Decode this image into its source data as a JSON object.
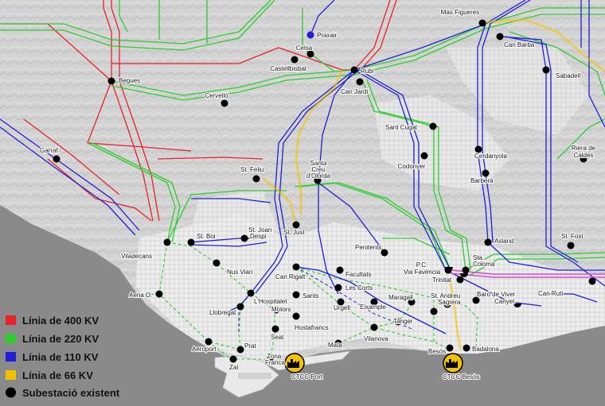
{
  "legend": {
    "line_400": {
      "label": "Línia de 400 KV",
      "color": "#e8202a"
    },
    "line_220": {
      "label": "Línia de 220 KV",
      "color": "#2ecc2e"
    },
    "line_110": {
      "label": "Línia de 110 KV",
      "color": "#1f1fd6"
    },
    "line_66": {
      "label": "Línia de 66 KV",
      "color": "#f2c200"
    },
    "substation": {
      "label": "Subestació existent",
      "color": "#000000"
    }
  },
  "places": {
    "mas_figueres": "Mas Figueres",
    "praxair": "Praxair",
    "can_barba": "Can Barba",
    "celsa": "Celsa",
    "castellbisbal": "Castellbisbal",
    "begues": "Begues",
    "rubi": "Rubí",
    "can_jardi": "Can Jardí",
    "sabadell": "Sabadell",
    "cervello": "Cervelló",
    "sant_cugat": "Sant Cugat",
    "garraf": "Garraf",
    "cerdanyola": "Cerdanyola",
    "riera_de": "Riera de",
    "caldes": "Caldes",
    "st_feliu": "St. Feliu",
    "santa": "Santa",
    "creu": "Creu",
    "dolorda": "d'Olorda",
    "codonyer": "Codonyer",
    "barbera": "Barberà",
    "st_boi": "St. Boi",
    "st_joan": "St. Joan",
    "despi": "Despí",
    "st_just": "St. Just",
    "penitents": "Penitents",
    "asland": "Asland",
    "st_fost": "St. Fost",
    "viladecans": "Viladecans",
    "nus_viari": "Nus Viari",
    "can_rigalt": "Can Rigalt",
    "facultats": "Facultats",
    "pc": "P.C.",
    "via_favencia": "Via Favència",
    "sta": "Sta.",
    "coloma": "Coloma",
    "trinitat": "Trinitat",
    "les_corts": "Les Corts",
    "aena_o": "Aena O.",
    "lhospitalet": "L'Hospitalet",
    "sants": "Sants",
    "st_andreu": "St. Andreu",
    "baro_de_viver": "Baró de Viver",
    "can_ruti": "Can Ruti",
    "canyet": "Canyet",
    "maragall": "Maragall",
    "sagrera": "Sagrera",
    "urgell": "Urgell",
    "eixample": "Eixample",
    "llobregat": "Llobregat",
    "motors": "Motors",
    "tanger": "Tanger",
    "hostafrancs": "Hostafrancs",
    "seat": "Seat",
    "vilanova": "Vilanova",
    "aeroport": "Aeroport",
    "prat": "Prat",
    "mata": "Mata",
    "besos": "Besòs",
    "badalona": "Badalona",
    "zona": "Zona",
    "franca": "Franca",
    "zal": "Zal",
    "ctcc_port": "CTCC Port",
    "ctcc_besos": "CTCC Besòs"
  }
}
